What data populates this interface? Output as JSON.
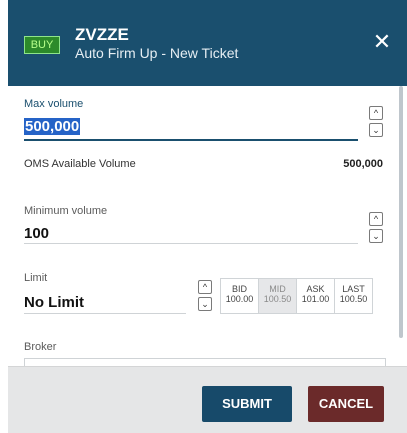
{
  "header": {
    "side_badge": "BUY",
    "symbol": "ZVZZE",
    "subtitle": "Auto Firm Up - New Ticket",
    "close_glyph": "✕"
  },
  "max_volume": {
    "label": "Max volume",
    "value": "500,000"
  },
  "oms": {
    "label": "OMS Available Volume",
    "value": "500,000"
  },
  "min_volume": {
    "label": "Minimum volume",
    "value": "100"
  },
  "limit": {
    "label": "Limit",
    "value": "No Limit",
    "prices": [
      {
        "label": "BID",
        "value": "100.00"
      },
      {
        "label": "MID",
        "value": "100.50"
      },
      {
        "label": "ASK",
        "value": "101.00"
      },
      {
        "label": "LAST",
        "value": "100.50"
      }
    ]
  },
  "broker": {
    "label": "Broker",
    "value": ""
  },
  "spinner": {
    "up": "^",
    "down": "⌄"
  },
  "footer": {
    "submit_label": "SUBMIT",
    "cancel_label": "CANCEL"
  },
  "colors": {
    "header_bg": "#1a4f6e",
    "buy_badge": "#2c8a2a",
    "submit": "#174a6a",
    "cancel": "#6b2a2a"
  }
}
